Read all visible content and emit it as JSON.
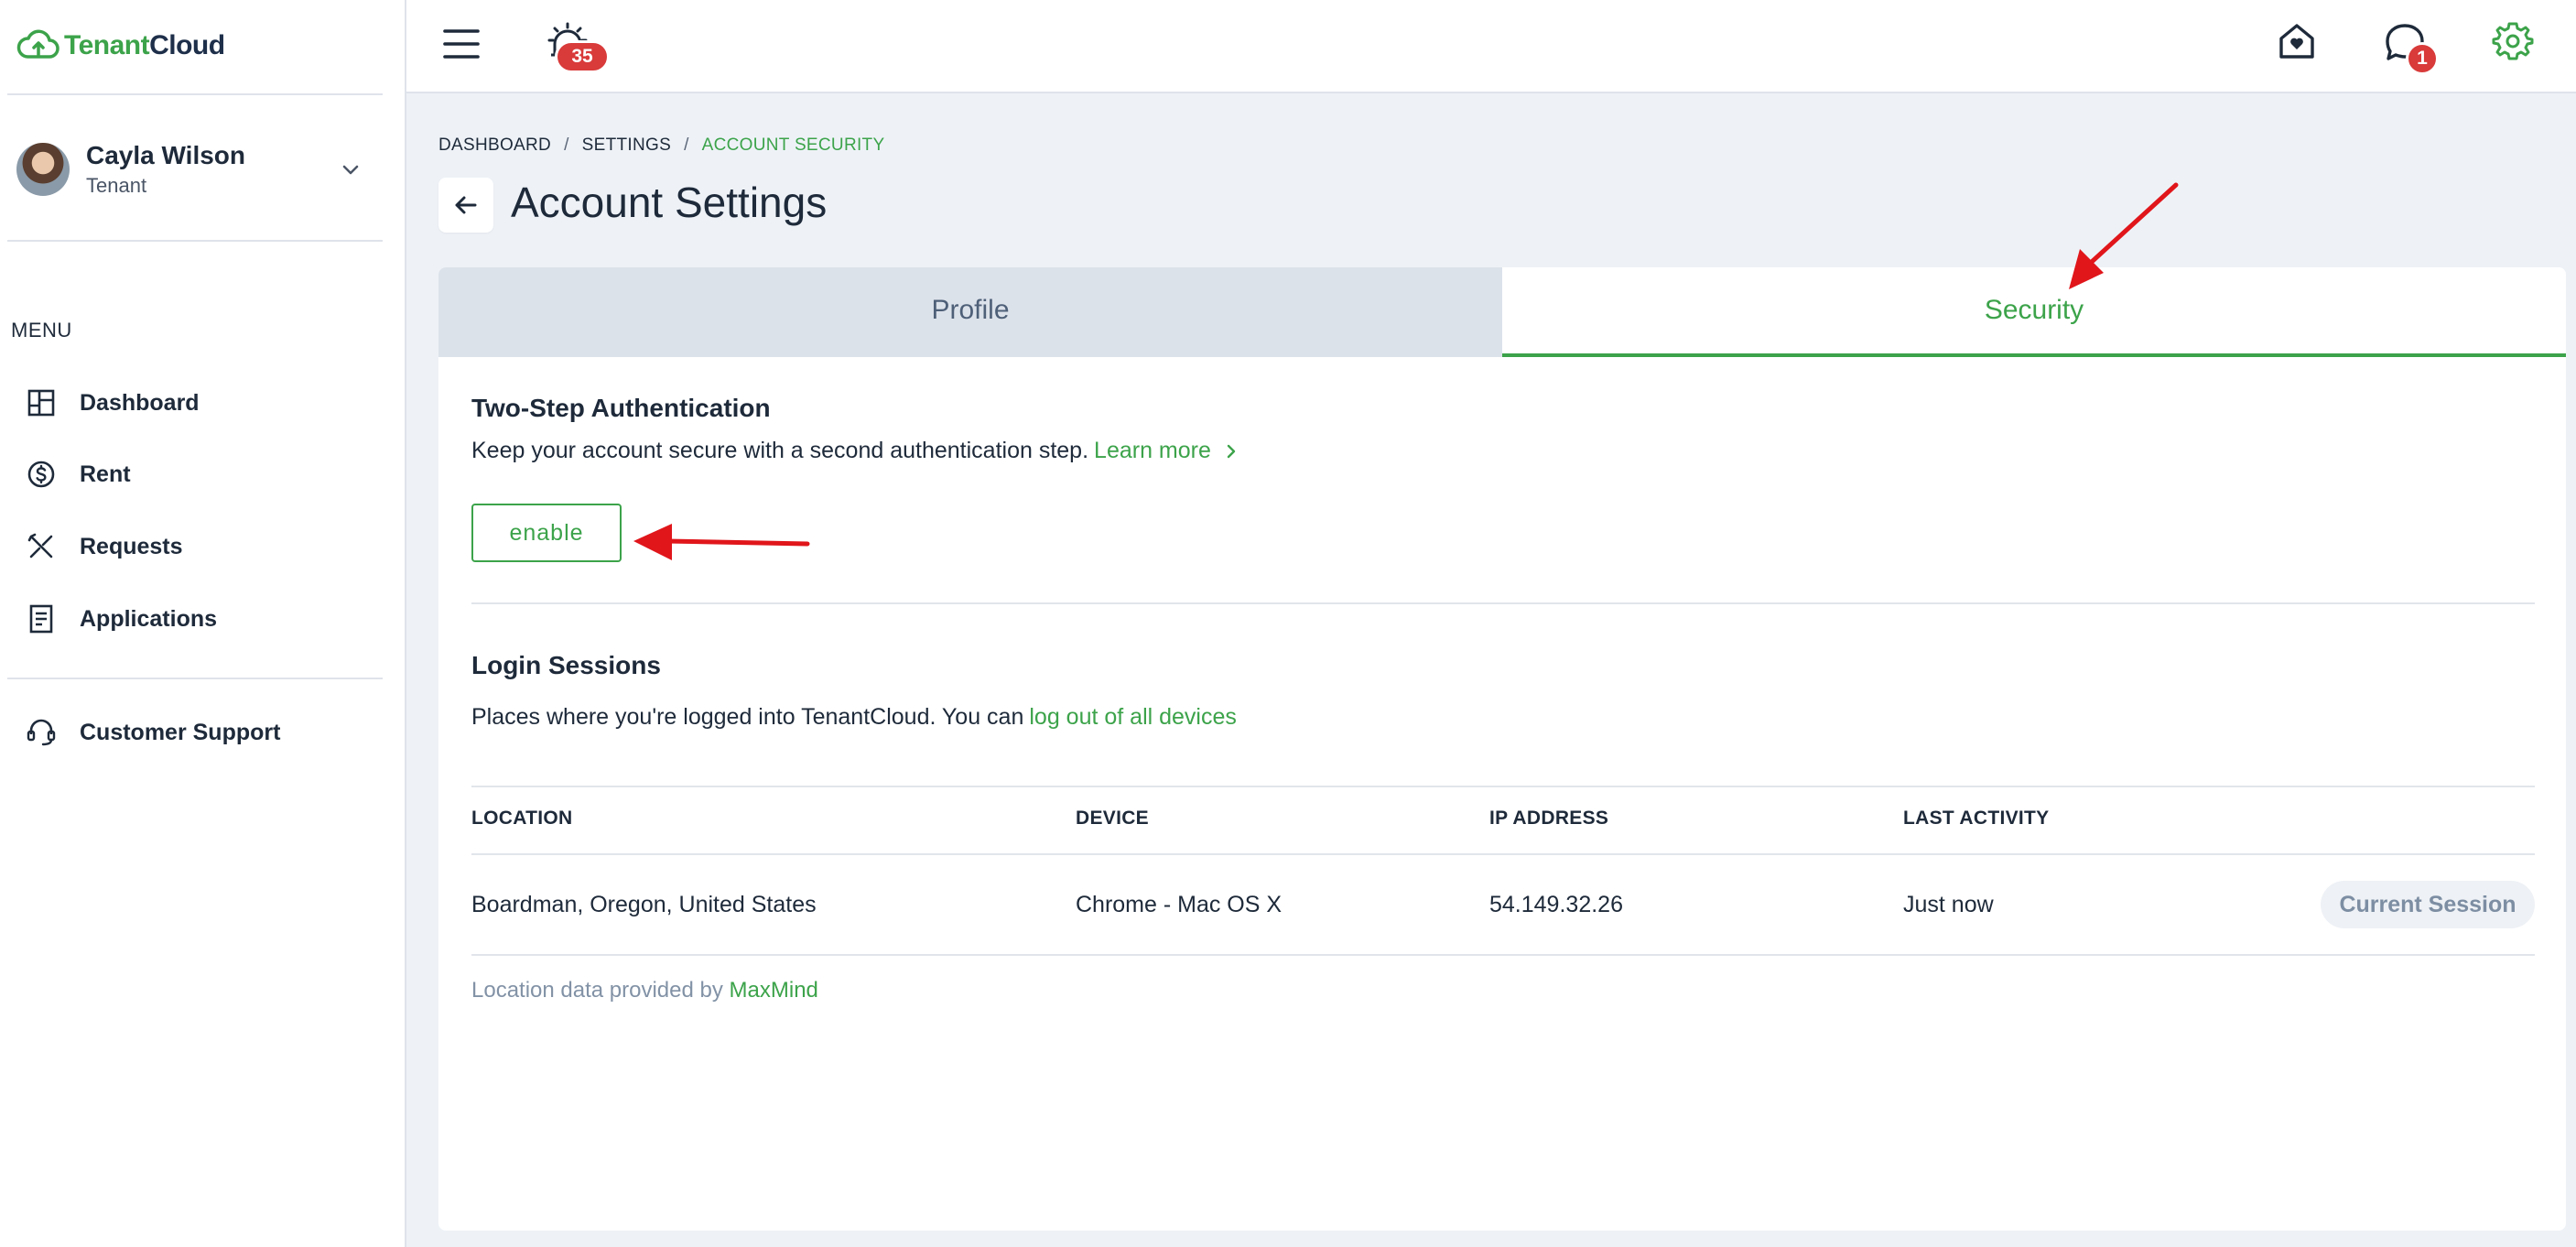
{
  "brand": {
    "name_part1": "Tenant",
    "name_part2": "Cloud",
    "accent": "#3ca34a",
    "navy": "#1e2f4a"
  },
  "user": {
    "name": "Cayla Wilson",
    "role": "Tenant"
  },
  "menu": {
    "heading": "MENU",
    "items": [
      {
        "label": "Dashboard",
        "icon": "dashboard-icon"
      },
      {
        "label": "Rent",
        "icon": "dollar-icon"
      },
      {
        "label": "Requests",
        "icon": "tools-icon"
      },
      {
        "label": "Applications",
        "icon": "document-icon"
      }
    ],
    "support": {
      "label": "Customer Support",
      "icon": "headset-icon"
    }
  },
  "topbar": {
    "alarm_count": "35",
    "chat_count": "1",
    "icons": [
      "hamburger-icon",
      "alarm-icon",
      "home-heart-icon",
      "chat-icon",
      "gear-icon"
    ]
  },
  "breadcrumb": {
    "items": [
      "DASHBOARD",
      "SETTINGS",
      "ACCOUNT SECURITY"
    ],
    "separator": "/"
  },
  "page": {
    "title": "Account Settings"
  },
  "tabs": {
    "profile": "Profile",
    "security": "Security",
    "active": "Security"
  },
  "two_step": {
    "title": "Two-Step Authentication",
    "description": "Keep your account secure with a second authentication step.",
    "learn_more": "Learn more",
    "button": "enable"
  },
  "sessions": {
    "title": "Login Sessions",
    "description": "Places where you're logged into TenantCloud. You can",
    "logout_link": "log out of all devices",
    "columns": [
      "LOCATION",
      "DEVICE",
      "IP ADDRESS",
      "LAST ACTIVITY"
    ],
    "rows": [
      {
        "location": "Boardman, Oregon, United States",
        "device": "Chrome - Mac OS X",
        "ip": "54.149.32.26",
        "last_activity": "Just now",
        "status": "Current Session"
      }
    ],
    "footnote_text": "Location data provided by",
    "footnote_link": "MaxMind"
  }
}
